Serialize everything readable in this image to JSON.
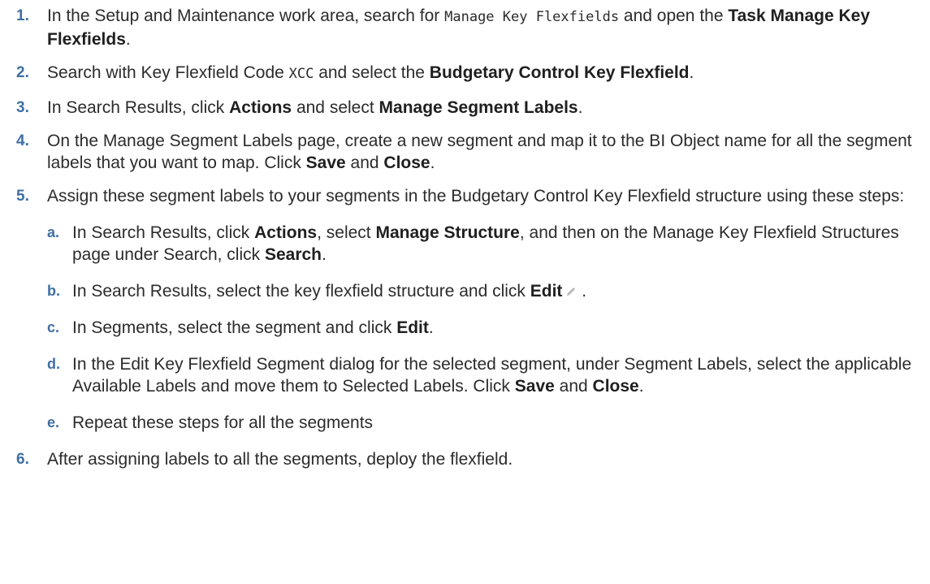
{
  "steps": [
    {
      "num": "1.",
      "t1": "In the Setup and Maintenance work area, search for ",
      "code": "Manage Key Flexfields",
      "t2": " and open the ",
      "b1": "Task Manage Key Flexfields",
      "t3": "."
    },
    {
      "num": "2.",
      "t1": "Search with Key Flexfield Code ",
      "code": "XCC",
      "t2": " and select the ",
      "b1": "Budgetary Control Key Flexfield",
      "t3": "."
    },
    {
      "num": "3.",
      "t1": "In Search Results, click ",
      "b1": "Actions",
      "t2": " and select ",
      "b2": "Manage Segment Labels",
      "t3": "."
    },
    {
      "num": "4.",
      "t1": "On the Manage Segment Labels page, create a new segment and map it to the BI Object name for all the segment labels that you want to map. Click ",
      "b1": "Save",
      "t2": " and ",
      "b2": "Close",
      "t3": "."
    },
    {
      "num": "5.",
      "t1": "Assign these segment labels to your segments in the Budgetary Control Key Flexfield structure using these steps:",
      "sub": [
        {
          "num": "a.",
          "t1": "In Search Results, click ",
          "b1": "Actions",
          "t2": ", select ",
          "b2": "Manage Structure",
          "t3": ", and then on the Manage Key Flexfield Structures page under Search, click ",
          "b3": "Search",
          "t4": "."
        },
        {
          "num": "b.",
          "t1": "In Search Results, select the key flexfield structure and click ",
          "b1": "Edit",
          "t2": " ."
        },
        {
          "num": "c.",
          "t1": "In Segments, select the segment and click ",
          "b1": "Edit",
          "t2": "."
        },
        {
          "num": "d.",
          "t1": "In the Edit Key Flexfield Segment dialog for the selected segment, under Segment Labels, select the applicable Available Labels and move them to Selected Labels. Click ",
          "b1": "Save",
          "t2": " and ",
          "b2": "Close",
          "t3": "."
        },
        {
          "num": "e.",
          "t1": "Repeat these steps for all the segments"
        }
      ]
    },
    {
      "num": "6.",
      "t1": "After assigning labels to all the segments, deploy the flexfield."
    }
  ],
  "icons": {
    "edit": "pencil-icon",
    "edit_color": "#b8b8b8"
  },
  "colors": {
    "step_number": "#3f6fa3",
    "text": "#2b2b2b"
  }
}
